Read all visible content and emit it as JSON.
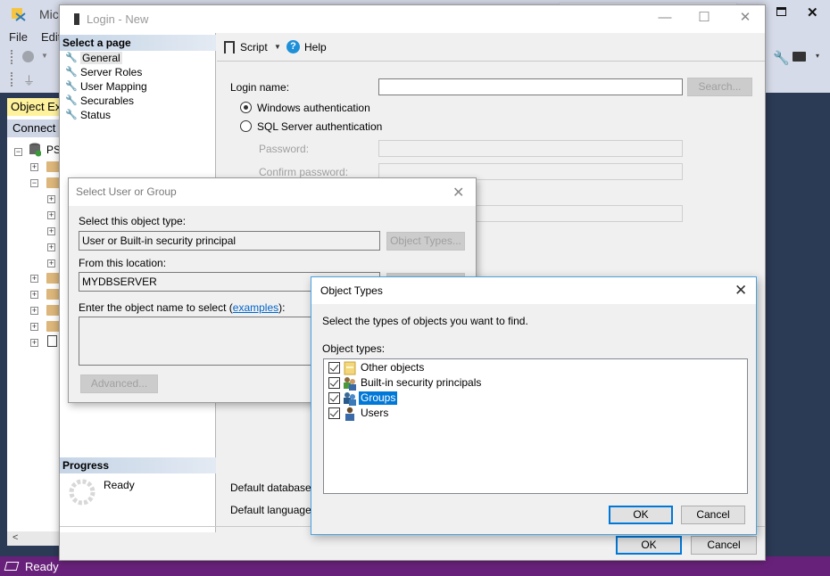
{
  "ssms": {
    "title": "Microsoft SQL Server Management Studio",
    "menu": [
      "File",
      "Edit"
    ],
    "object_explorer": {
      "tab_label": "Object Explorer",
      "connect_label": "Connect",
      "server_label": "PSI"
    },
    "status": "Ready"
  },
  "login_dialog": {
    "title": "Login - New",
    "select_page_header": "Select a page",
    "pages": [
      {
        "label": "General",
        "selected": true
      },
      {
        "label": "Server Roles",
        "selected": false
      },
      {
        "label": "User Mapping",
        "selected": false
      },
      {
        "label": "Securables",
        "selected": false
      },
      {
        "label": "Status",
        "selected": false
      }
    ],
    "toolbar": {
      "script_label": "Script",
      "help_label": "Help"
    },
    "form": {
      "login_name_label": "Login name:",
      "login_name_value": "",
      "search_button": "Search...",
      "windows_auth": "Windows authentication",
      "sql_auth": "SQL Server authentication",
      "auth_selected": "Windows authentication",
      "password_label": "Password:",
      "confirm_password_label": "Confirm password:",
      "default_database_label": "Default database:",
      "default_language_label": "Default language:"
    },
    "progress_header": "Progress",
    "progress_status": "Ready",
    "ok_button": "OK",
    "cancel_button": "Cancel"
  },
  "select_user_dialog": {
    "title": "Select User or Group",
    "object_type_label": "Select this object type:",
    "object_type_value": "User or Built-in security principal",
    "object_types_button": "Object Types...",
    "location_label": "From this location:",
    "location_value": "MYDBSERVER",
    "enter_name_label": "Enter the object name to select (",
    "examples_link": "examples",
    "enter_name_suffix": "):",
    "advanced_button": "Advanced..."
  },
  "object_types_dialog": {
    "title": "Object Types",
    "instruction": "Select the types of objects you want to find.",
    "list_label": "Object types:",
    "items": [
      {
        "label": "Other objects",
        "checked": true,
        "icon": "folder-object-icon",
        "selected": false
      },
      {
        "label": "Built-in security principals",
        "checked": true,
        "icon": "security-principals-icon",
        "selected": false
      },
      {
        "label": "Groups",
        "checked": true,
        "icon": "group-icon",
        "selected": true
      },
      {
        "label": "Users",
        "checked": true,
        "icon": "user-icon",
        "selected": false
      }
    ],
    "ok_button": "OK",
    "cancel_button": "Cancel"
  }
}
